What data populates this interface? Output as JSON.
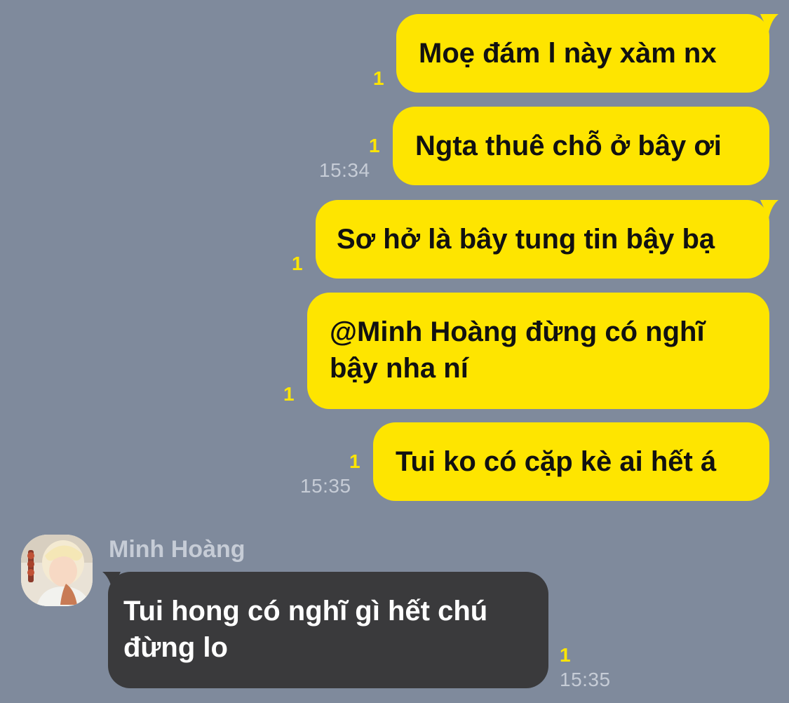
{
  "messages": [
    {
      "direction": "out",
      "text": "Moẹ đám l này xàm nx",
      "unread": "1"
    },
    {
      "direction": "out",
      "text": "Ngta thuê chỗ ở bây ơi",
      "unread": "1",
      "time": "15:34"
    },
    {
      "direction": "out",
      "text": "Sơ hở là bây tung tin bậy bạ",
      "unread": "1"
    },
    {
      "direction": "out",
      "text": "@Minh Hoàng đừng có nghĩ\nbậy nha ní",
      "unread": "1"
    },
    {
      "direction": "out",
      "text": "Tui ko có cặp kè ai hết á",
      "unread": "1",
      "time": "15:35"
    },
    {
      "direction": "in",
      "sender": "Minh Hoàng",
      "text": "Tui hong có nghĩ gì hết chú\nđừng lo",
      "unread": "1",
      "time": "15:35"
    }
  ],
  "colors": {
    "background": "#7f8a9c",
    "outgoing_bubble": "#fee500",
    "incoming_bubble": "#3a3a3c",
    "unread": "#fee500",
    "meta_text": "#c6ccd6"
  },
  "icons": {
    "avatar": "user-avatar-photo"
  }
}
